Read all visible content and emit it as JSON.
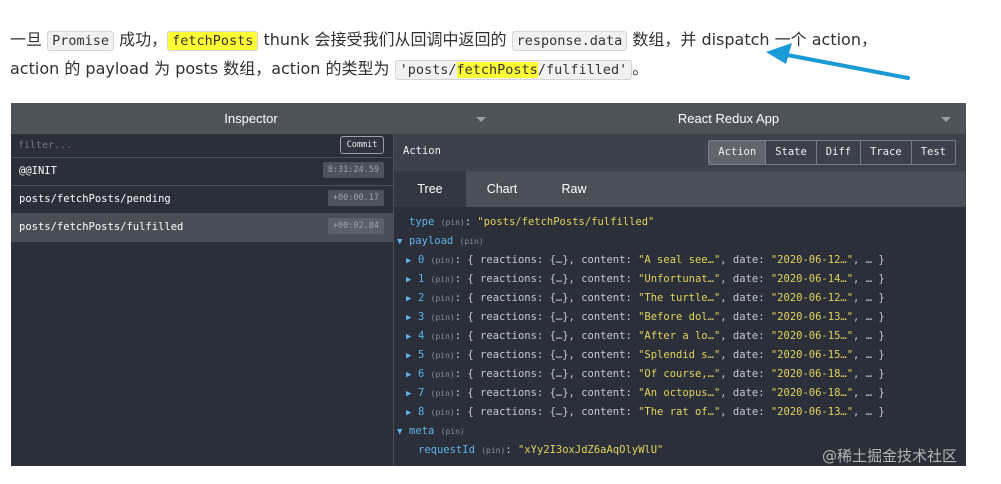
{
  "article": {
    "p1": "一旦 ",
    "c1": "Promise",
    "p2": " 成功，",
    "c2": "fetchPosts",
    "p3": " thunk 会接受我们从回调中返回的 ",
    "c3": "response.data",
    "p4": " 数组，并 dispatch 一个 action，",
    "p5": "action 的 payload 为 posts 数组，action 的类型为 ",
    "c4a": "'posts/",
    "c4b": "fetchPosts",
    "c4c": "/fulfilled'",
    "p6": "。"
  },
  "devtools": {
    "left_monitor": "Inspector",
    "right_monitor": "React Redux App",
    "filter_placeholder": "filter...",
    "commit_label": "Commit",
    "actions": [
      {
        "name": "@@INIT",
        "time": "8:31:24.59"
      },
      {
        "name": "posts/fetchPosts/pending",
        "time": "+00:00.17"
      },
      {
        "name": "posts/fetchPosts/fulfilled",
        "time": "+00:02.84"
      }
    ],
    "panel_title": "Action",
    "tabs": [
      "Action",
      "State",
      "Diff",
      "Trace",
      "Test"
    ],
    "subtabs": [
      "Tree",
      "Chart",
      "Raw"
    ],
    "tree": {
      "type_key": "type",
      "pin": "(pin)",
      "type_value": "\"posts/fetchPosts/fulfilled\"",
      "payload_key": "payload",
      "items": [
        {
          "idx": "0",
          "content": "\"A seal see…\"",
          "date": "\"2020-06-12…\""
        },
        {
          "idx": "1",
          "content": "\"Unfortunat…\"",
          "date": "\"2020-06-14…\""
        },
        {
          "idx": "2",
          "content": "\"The turtle…\"",
          "date": "\"2020-06-12…\""
        },
        {
          "idx": "3",
          "content": "\"Before dol…\"",
          "date": "\"2020-06-13…\""
        },
        {
          "idx": "4",
          "content": "\"After a lo…\"",
          "date": "\"2020-06-15…\""
        },
        {
          "idx": "5",
          "content": "\"Splendid s…\"",
          "date": "\"2020-06-15…\""
        },
        {
          "idx": "6",
          "content": "\"Of course,…\"",
          "date": "\"2020-06-18…\""
        },
        {
          "idx": "7",
          "content": "\"An octopus…\"",
          "date": "\"2020-06-18…\""
        },
        {
          "idx": "8",
          "content": "\"The rat of…\"",
          "date": "\"2020-06-13…\""
        }
      ],
      "reactions_text": "{ reactions: {…}, content: ",
      "date_text": ", date: ",
      "tail_text": ", … }",
      "meta_key": "meta",
      "request_key": "requestId",
      "request_value": "\"xYy2I3oxJdZ6aAqOlyWlU\""
    }
  },
  "watermark": "@稀土掘金技术社区",
  "colors": {
    "arrow": "#1a9ad6",
    "highlight": "#ffff35"
  }
}
